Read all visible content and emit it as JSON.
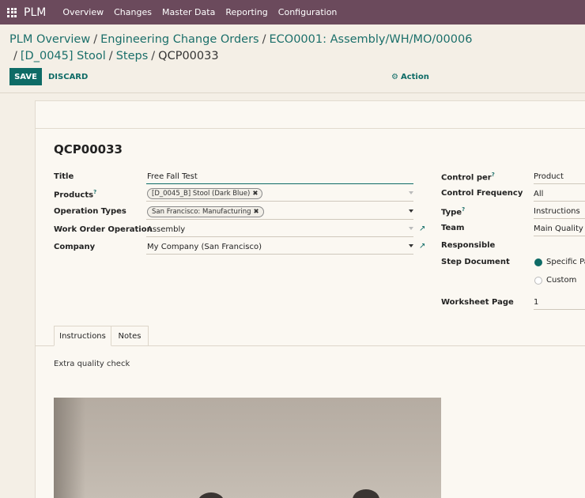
{
  "navbar": {
    "brand": "PLM",
    "items": [
      "Overview",
      "Changes",
      "Master Data",
      "Reporting",
      "Configuration"
    ]
  },
  "breadcrumbs": {
    "items": [
      "PLM Overview",
      "Engineering Change Orders",
      "ECO0001: Assembly/WH/MO/00006",
      "[D_0045] Stool",
      "Steps"
    ],
    "current": "QCP00033"
  },
  "controls": {
    "save": "SAVE",
    "discard": "DISCARD",
    "action": "Action"
  },
  "record": {
    "title": "QCP00033"
  },
  "left_fields": {
    "title_label": "Title",
    "title_value": "Free Fall Test",
    "products_label": "Products",
    "products_tag": "[D_0045_B] Stool (Dark Blue)",
    "operation_types_label": "Operation Types",
    "operation_types_tag": "San Francisco: Manufacturing",
    "work_order_label": "Work Order Operation",
    "work_order_value": "Assembly",
    "company_label": "Company",
    "company_value": "My Company (San Francisco)"
  },
  "right_fields": {
    "control_per_label": "Control per",
    "control_per_value": "Product",
    "control_frequency_label": "Control Frequency",
    "control_frequency_value": "All",
    "type_label": "Type",
    "type_value": "Instructions",
    "team_label": "Team",
    "team_value": "Main Quality T",
    "responsible_label": "Responsible",
    "step_document_label": "Step Document",
    "step_document_options": [
      "Specific Pa",
      "Custom"
    ],
    "worksheet_page_label": "Worksheet Page",
    "worksheet_page_value": "1"
  },
  "tabs": [
    "Instructions",
    "Notes"
  ],
  "instructions": {
    "text": "Extra quality check"
  },
  "colors": {
    "navbar": "#6b4a5c",
    "primary": "#0e6b66",
    "background": "#f4efe6"
  }
}
